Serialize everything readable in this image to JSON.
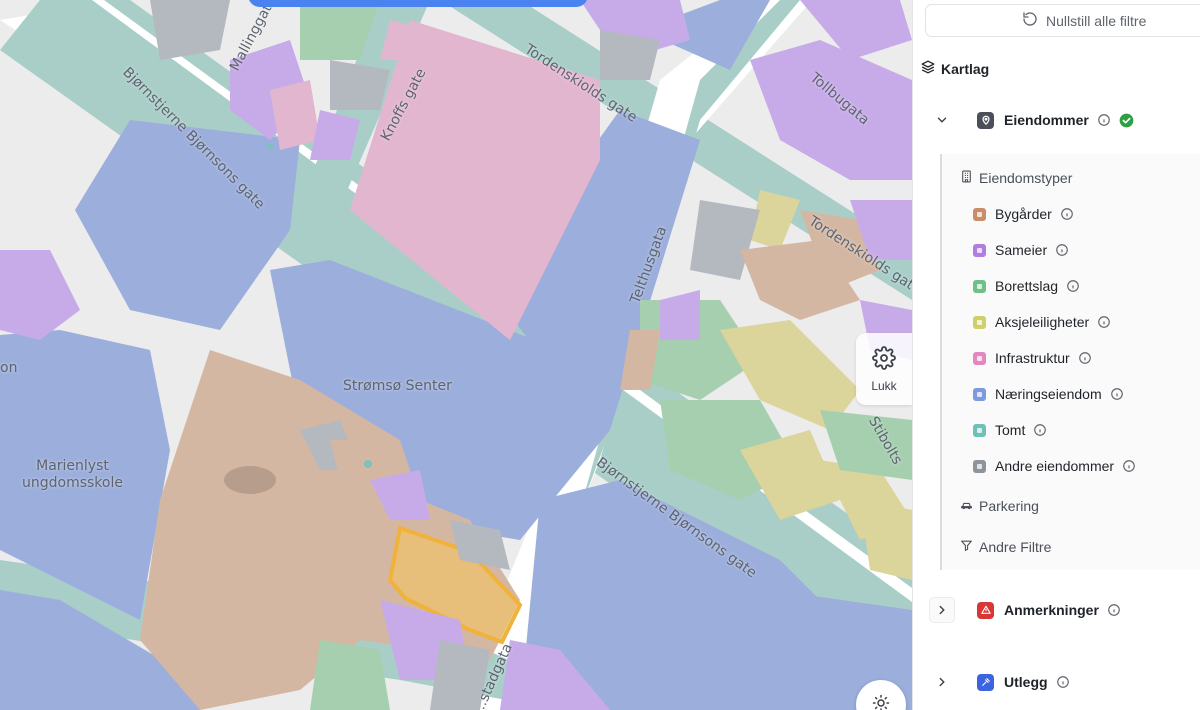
{
  "map": {
    "labels": {
      "street_bjornson_1": "Bjørnstjerne Bjørnsons gate",
      "street_bjornson_2": "Bjørnstjerne Bjørnsons gate",
      "street_mallinggata": "Mallinggata",
      "street_knoffs": "Knoffs gate",
      "street_tordenskiolds_1": "Tordenskiolds gate",
      "street_tordenskiolds_2": "Tordenskiolds gate",
      "street_tollbugata": "Tollbugata",
      "street_telthusgata": "Telthusgata",
      "street_stiboltsgate": "Stibolts",
      "street_bottom": "...stadgata",
      "place_stromso_senter": "Strømsø Senter",
      "place_marienlyst": "Marienlyst\nungdomsskole",
      "place_edge": "on"
    },
    "settings_button_label": "Lukk",
    "colors": {
      "road_area": "#a9cec8",
      "commercial": "#9caedb",
      "residential_condo": "#c7abe8",
      "rental": "#e3b6d0",
      "city_block": "#d4b7a3",
      "green": "#a6cfb0",
      "yellow": "#dbd49b",
      "grey": "#b4b8bf",
      "highlight": "#f0b94c"
    }
  },
  "panel": {
    "reset_filters_label": "Nullstill alle filtre",
    "section_title": "Kartlag",
    "layers": [
      {
        "label": "Eiendommer",
        "icon": "location-pin-icon",
        "color": "#4a4f5a",
        "expanded": true,
        "active": true
      },
      {
        "label": "Anmerkninger",
        "icon": "warning-triangle-icon",
        "color": "#d93636",
        "expanded": false,
        "active": false
      },
      {
        "label": "Utlegg",
        "icon": "gavel-icon",
        "color": "#3b64e0",
        "expanded": false,
        "active": false
      }
    ],
    "property_types_heading": "Eiendomstyper",
    "property_types": [
      {
        "label": "Bygårder",
        "color": "#c98d6a"
      },
      {
        "label": "Sameier",
        "color": "#b07de3"
      },
      {
        "label": "Borettslag",
        "color": "#6fc08a"
      },
      {
        "label": "Aksjeleiligheter",
        "color": "#cfd06a"
      },
      {
        "label": "Infrastruktur",
        "color": "#e387c0"
      },
      {
        "label": "Næringseiendom",
        "color": "#7d9ae0"
      },
      {
        "label": "Tomt",
        "color": "#6fc0b8"
      },
      {
        "label": "Andre eiendommer",
        "color": "#8f939b"
      }
    ],
    "parking_label": "Parkering",
    "other_filters_label": "Andre Filtre",
    "check_color": "#2ea043"
  }
}
